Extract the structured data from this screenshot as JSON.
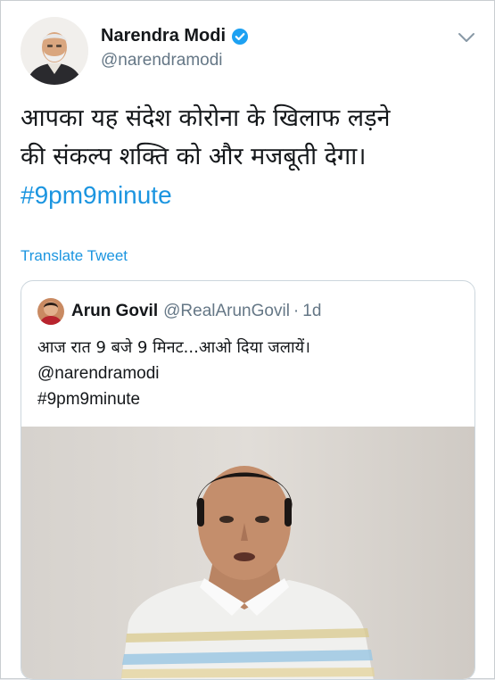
{
  "tweet": {
    "author_name": "Narendra Modi",
    "author_handle": "@narendramodi",
    "text_line1": "आपका यह संदेश कोरोना के खिलाफ लड़ने",
    "text_line2": "की संकल्प शक्ति को और मजबूती देगा।",
    "hashtag": "#9pm9minute",
    "translate_label": "Translate Tweet"
  },
  "quoted_tweet": {
    "author_name": "Arun Govil",
    "author_handle": "@RealArunGovil",
    "separator": "·",
    "time": "1d",
    "text_line1": "आज रात 9 बजे 9 मिनट...आओ दिया जलायें।",
    "mention": "@narendramodi",
    "hashtag": "#9pm9minute"
  },
  "icons": {
    "verified": "verified-badge-icon",
    "chevron": "chevron-down-icon"
  },
  "colors": {
    "link": "#1b95e0",
    "secondary_text": "#657786",
    "verified": "#1da1f2"
  }
}
